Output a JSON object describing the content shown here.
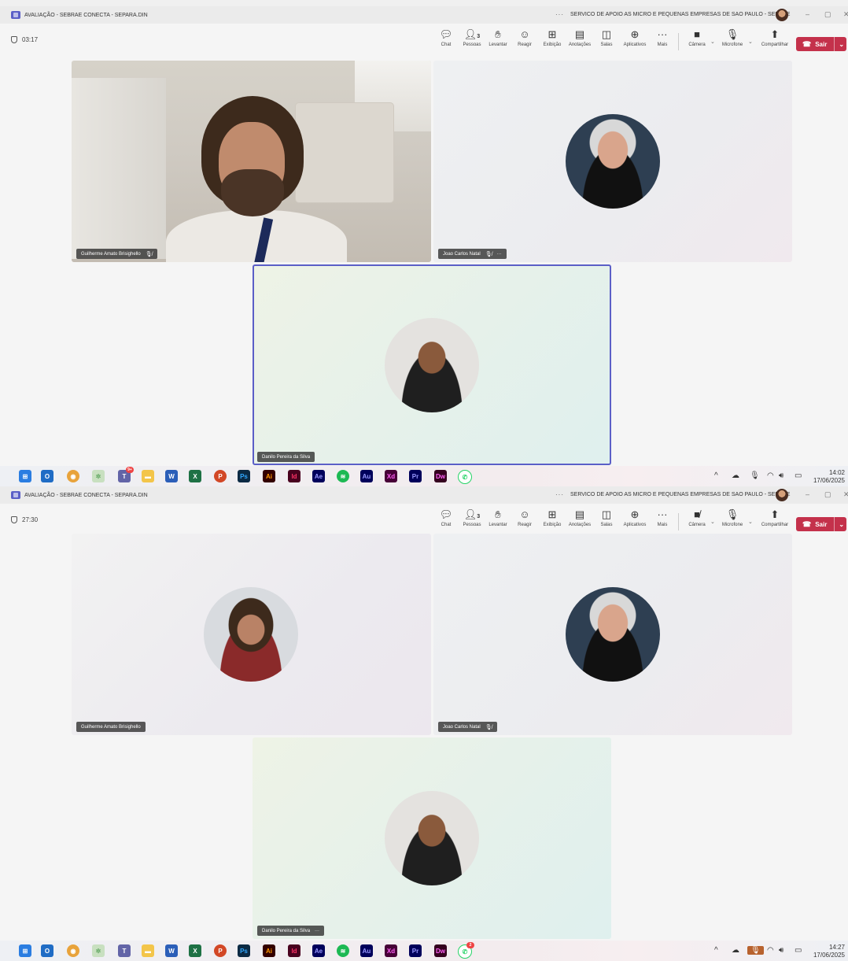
{
  "screens": [
    {
      "title_bar": {
        "meeting_title": "AVALIAÇÃO - SEBRAE CONECTA - SEPARA.DIN",
        "organization": "SERVICO DE APOIO AS MICRO E PEQUENAS EMPRESAS DE SAO PAULO - SEBRAE",
        "more": "···",
        "minimize": "–",
        "maximize": "▢",
        "close": "✕"
      },
      "meeting_timer": "03:17",
      "controls": {
        "chat": "Chat",
        "people": "Pessoas",
        "people_count": "3",
        "raise_hand": "Levantar",
        "react": "Reagir",
        "view": "Exibição",
        "notes": "Anotações",
        "rooms": "Salas",
        "apps": "Aplicativos",
        "more": "Mais",
        "camera": "Câmera",
        "camera_state": "on",
        "microphone": "Microfone",
        "microphone_state": "muted",
        "share": "Compartilhar",
        "leave": "Sair"
      },
      "participants": [
        {
          "name": "Guilherme Amato Brisighello",
          "muted": true,
          "video": "camera"
        },
        {
          "name": "Joao Carlos Natal",
          "muted": true,
          "video": "avatar",
          "more": "···"
        },
        {
          "name": "Danilo Pereira da Silva",
          "muted": false,
          "video": "avatar",
          "active_speaker": true
        }
      ],
      "taskbar": {
        "time": "14:02",
        "date": "17/06/2025",
        "teams_badge": "9+"
      }
    },
    {
      "title_bar": {
        "meeting_title": "AVALIAÇÃO - SEBRAE CONECTA - SEPARA.DIN",
        "organization": "SERVICO DE APOIO AS MICRO E PEQUENAS EMPRESAS DE SAO PAULO - SEBRAE",
        "more": "···",
        "minimize": "–",
        "maximize": "▢",
        "close": "✕"
      },
      "meeting_timer": "27:30",
      "controls": {
        "chat": "Chat",
        "people": "Pessoas",
        "people_count": "3",
        "raise_hand": "Levantar",
        "react": "Reagir",
        "view": "Exibição",
        "notes": "Anotações",
        "rooms": "Salas",
        "apps": "Aplicativos",
        "more": "Mais",
        "camera": "Câmera",
        "camera_state": "off",
        "microphone": "Microfone",
        "microphone_state": "on",
        "share": "Compartilhar",
        "leave": "Sair"
      },
      "participants": [
        {
          "name": "Guilherme Amato Brisighello",
          "muted": false,
          "video": "avatar"
        },
        {
          "name": "Joao Carlos Natal",
          "muted": true,
          "video": "avatar"
        },
        {
          "name": "Danilo Pereira da Silva",
          "muted": false,
          "video": "avatar",
          "more": "···"
        }
      ],
      "taskbar": {
        "time": "14:27",
        "date": "17/06/2025",
        "whatsapp_badge": "2"
      }
    }
  ],
  "taskbar_apps": [
    "start",
    "outlook",
    "chrome",
    "copilot",
    "teams",
    "file-explorer",
    "word",
    "excel",
    "powerpoint",
    "photoshop",
    "illustrator",
    "indesign",
    "after-effects",
    "spotify",
    "audition",
    "xd",
    "premiere",
    "dreamweaver",
    "whatsapp"
  ],
  "taskbar_app_labels": {
    "photoshop": "Ps",
    "illustrator": "Ai",
    "indesign": "Id",
    "after_effects": "Ae",
    "audition": "Au",
    "xd": "Xd",
    "premiere": "Pr",
    "dreamweaver": "Dw",
    "word": "W",
    "excel": "X",
    "powerpoint": "P",
    "outlook": "O"
  },
  "colors": {
    "teams_purple": "#5b5fc7",
    "leave_red": "#c4314b",
    "active_speaker": "#5b5fc7"
  }
}
